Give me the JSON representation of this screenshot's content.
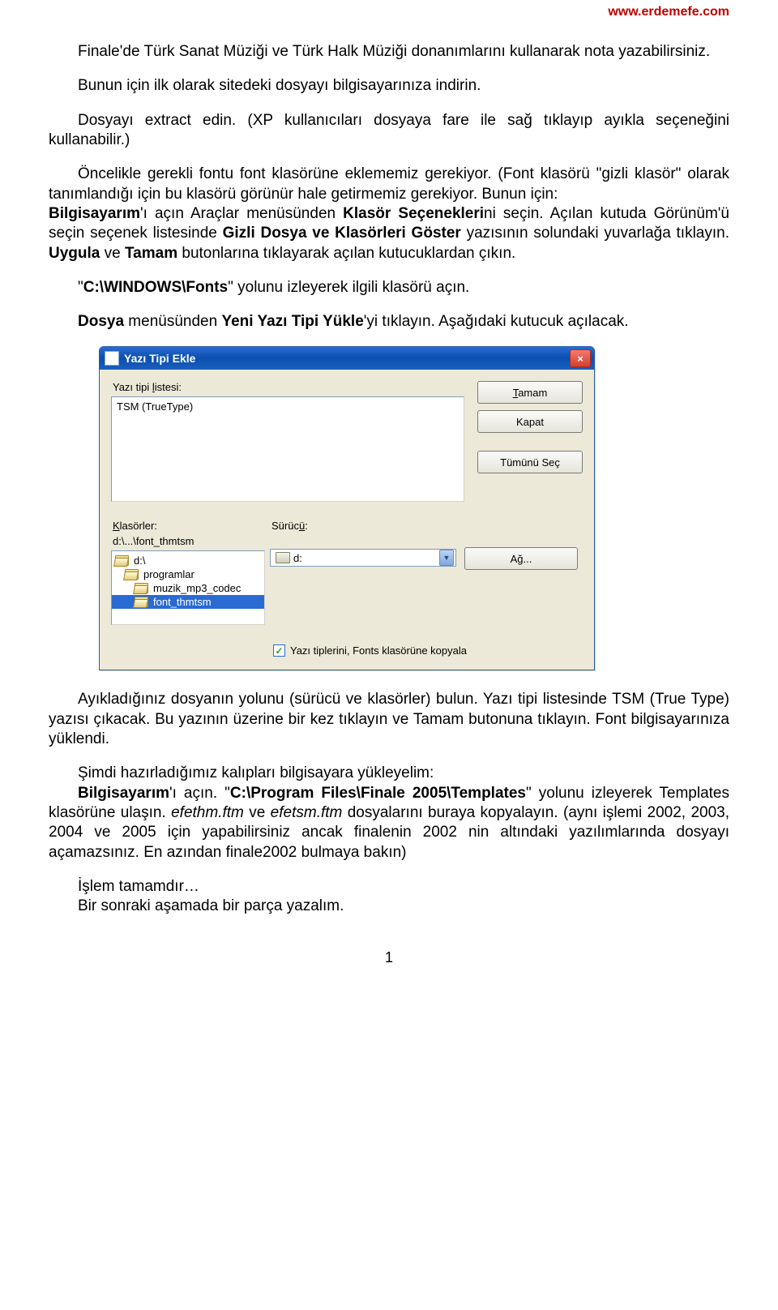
{
  "header_url": "www.erdemefe.com",
  "p1_a": "Finale'de Türk Sanat Müziği ve Türk Halk Müziği donanımlarını kullanarak nota yazabilirsiniz.",
  "p2_a": "Bunun için ilk olarak sitedeki dosyayı bilgisayarınıza indirin.",
  "p3_a": "Dosyayı extract edin. (XP kullanıcıları dosyaya fare ile sağ tıklayıp ayıkla seçeneğini kullanabilir.)",
  "p4_a": "Öncelikle gerekli fontu font klasörüne eklememiz gerekiyor. (Font klasörü \"gizli klasör\" olarak tanımlandığı için bu klasörü görünür hale getirmemiz gerekiyor. Bunun için:",
  "p4_b1": "Bilgisayarım",
  "p4_b2": "'ı açın Araçlar menüsünden ",
  "p4_b3": "Klasör Seçenekleri",
  "p4_b4": "ni seçin. Açılan kutuda Görünüm'ü seçin seçenek listesinde ",
  "p4_b5": "Gizli Dosya ve Klasörleri Göster",
  "p4_b6": " yazısının solundaki yuvarlağa tıklayın. ",
  "p4_b7": "Uygula",
  "p4_b8": " ve ",
  "p4_b9": "Tamam",
  "p4_b10": " butonlarına tıklayarak açılan kutucuklardan çıkın.",
  "p5_a": "\"",
  "p5_b": "C:\\WINDOWS\\Fonts",
  "p5_c": "\" yolunu izleyerek ilgili klasörü açın.",
  "p6_a": "Dosya",
  "p6_b": " menüsünden ",
  "p6_c": "Yeni Yazı Tipi Yükle",
  "p6_d": "'yi tıklayın. Aşağıdaki kutucuk açılacak.",
  "dialog": {
    "title": "Yazı Tipi Ekle",
    "close_glyph": "×",
    "label_list_prefix": "Yazı tipi ",
    "label_list_u": "l",
    "label_list_suffix": "istesi:",
    "list_item": "TSM (TrueType)",
    "btn_ok_u": "T",
    "btn_ok_suffix": "amam",
    "btn_close": "Kapat",
    "btn_selectall": "Tümünü Seç",
    "label_folders_u": "K",
    "label_folders_suffix": "lasörler:",
    "folders_path": "d:\\...\\font_thmtsm",
    "folder0": "d:\\",
    "folder1": "programlar",
    "folder2": "muzik_mp3_codec",
    "folder3": "font_thmtsm",
    "label_drive_prefix": "Sürüc",
    "label_drive_u": "ü",
    "label_drive_suffix": ":",
    "drive_value": "d:",
    "btn_network_prefix": "A",
    "btn_network_u": "ğ",
    "btn_network_suffix": "...",
    "checkbox_label": "Yazı tiplerini, Fonts klasörüne kopyala",
    "check_glyph": "✓",
    "dropdown_glyph": "▼"
  },
  "p7": "Ayıkladığınız dosyanın yolunu (sürücü ve klasörler) bulun. Yazı tipi listesinde TSM (True Type) yazısı çıkacak. Bu yazının üzerine bir kez tıklayın ve Tamam butonuna tıklayın. Font bilgisayarınıza yüklendi.",
  "p8_a": "Şimdi hazırladığımız kalıpları bilgisayara yükleyelim:",
  "p8_b1": "Bilgisayarım",
  "p8_b2": "'ı açın. \"",
  "p8_b3": "C:\\Program Files\\Finale 2005\\Templates",
  "p8_b4": "\" yolunu izleyerek Templates klasörüne ulaşın. ",
  "p8_i1": "efethm.ftm",
  "p8_b5": " ve ",
  "p8_i2": "efetsm.ftm",
  "p8_b6": " dosyalarını buraya kopyalayın. (aynı işlemi 2002, 2003, 2004 ve 2005 için yapabilirsiniz ancak finalenin 2002 nin altındaki yazılımlarında dosyayı açamazsınız. En azından finale2002 bulmaya bakın)",
  "p9_a": "İşlem tamamdır…",
  "p9_b": "Bir sonraki aşamada bir parça yazalım.",
  "page_number": "1"
}
